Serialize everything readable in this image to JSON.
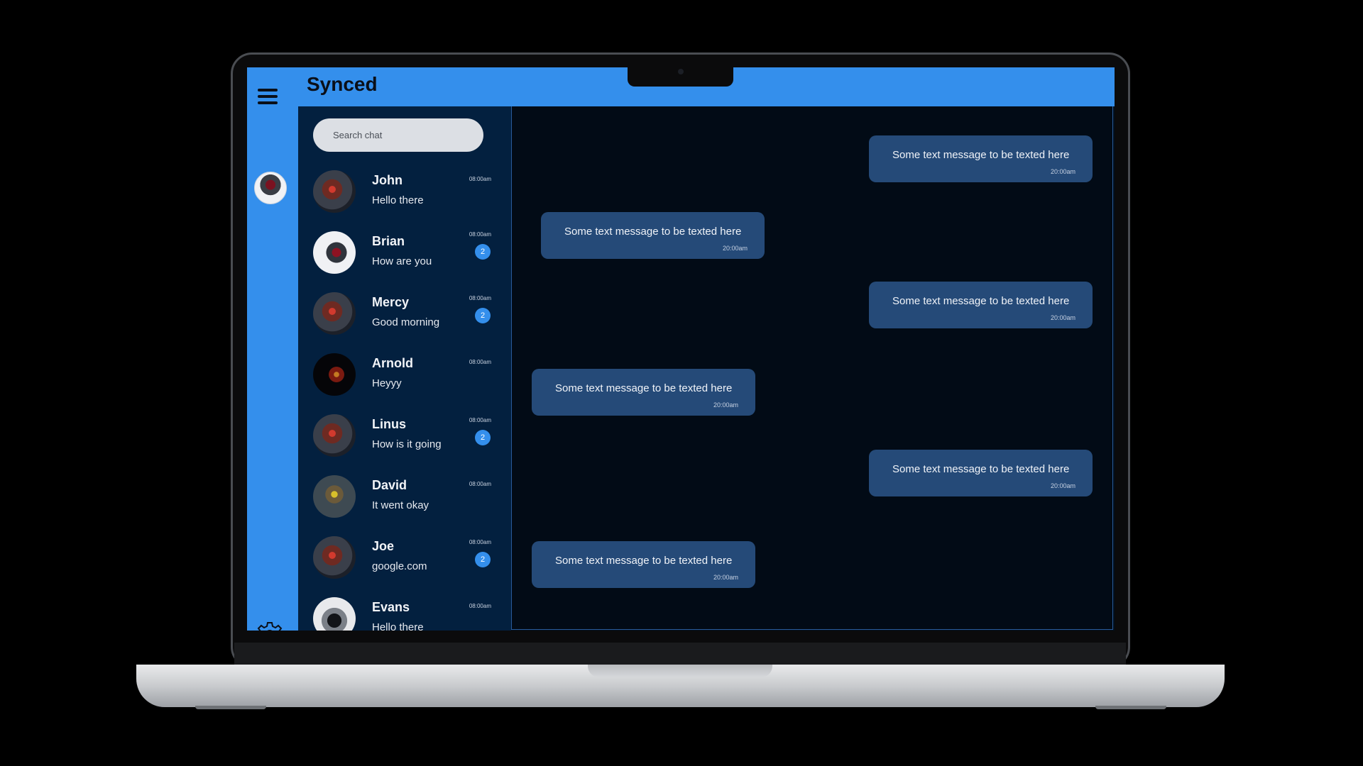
{
  "app": {
    "title": "Synced"
  },
  "rail": {
    "menu_icon": "hamburger-icon",
    "settings_icon": "gear-icon"
  },
  "search": {
    "placeholder": "Search chat"
  },
  "chats": [
    {
      "name": "John",
      "preview": "Hello there",
      "time": "08:00am",
      "badge": ""
    },
    {
      "name": "Brian",
      "preview": "How are you",
      "time": "08:00am",
      "badge": "2"
    },
    {
      "name": "Mercy",
      "preview": "Good morning",
      "time": "08:00am",
      "badge": "2"
    },
    {
      "name": "Arnold",
      "preview": "Heyyy",
      "time": "08:00am",
      "badge": ""
    },
    {
      "name": "Linus",
      "preview": "How is it going",
      "time": "08:00am",
      "badge": "2"
    },
    {
      "name": "David",
      "preview": "It went okay",
      "time": "08:00am",
      "badge": ""
    },
    {
      "name": "Joe",
      "preview": "google.com",
      "time": "08:00am",
      "badge": "2"
    },
    {
      "name": "Evans",
      "preview": "Hello there",
      "time": "08:00am",
      "badge": ""
    }
  ],
  "messages": [
    {
      "text": "Some text message to be texted here",
      "time": "20:00am",
      "side": "outgoing"
    },
    {
      "text": "Some text message to be texted here",
      "time": "20:00am",
      "side": "incoming"
    },
    {
      "text": "Some text message to be texted here",
      "time": "20:00am",
      "side": "outgoing"
    },
    {
      "text": "Some text message to be texted here",
      "time": "20:00am",
      "side": "incoming"
    },
    {
      "text": "Some text message to be texted here",
      "time": "20:00am",
      "side": "outgoing"
    },
    {
      "text": "Some text message to be texted here",
      "time": "20:00am",
      "side": "incoming"
    }
  ],
  "colors": {
    "accent": "#348fec",
    "sidebar": "#03203f",
    "conversation": "#020b16",
    "bubble": "#254a78"
  }
}
